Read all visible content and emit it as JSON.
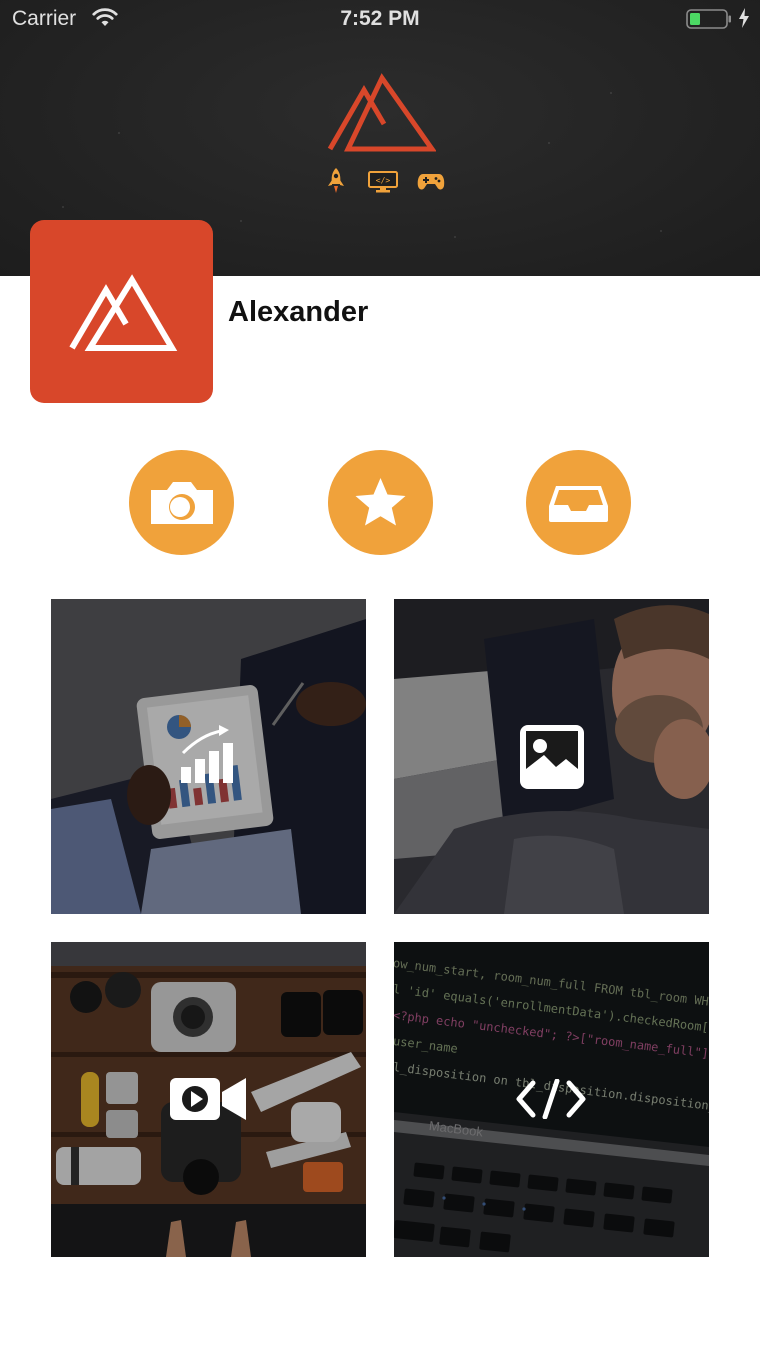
{
  "status_bar": {
    "carrier": "Carrier",
    "time": "7:52 PM"
  },
  "header": {
    "logo_icon": "mountain-logo-icon",
    "category_icons": [
      "rocket-icon",
      "code-monitor-icon",
      "gamepad-icon"
    ],
    "monitor_label": "</>"
  },
  "profile": {
    "name": "Alexander",
    "avatar_icon": "mountain-logo-icon"
  },
  "actions": [
    {
      "name": "camera-button",
      "icon": "camera-icon"
    },
    {
      "name": "favorites-button",
      "icon": "star-icon"
    },
    {
      "name": "inbox-button",
      "icon": "inbox-tray-icon"
    }
  ],
  "tiles": [
    {
      "name": "analytics-tile",
      "icon": "bar-chart-icon",
      "photo": "tablet-with-chart"
    },
    {
      "name": "photos-tile",
      "icon": "image-icon",
      "photo": "man-portrait"
    },
    {
      "name": "videos-tile",
      "icon": "video-camera-icon",
      "photo": "camera-gear-flatlay"
    },
    {
      "name": "code-tile",
      "icon": "code-icon",
      "photo": "laptop-code-screen"
    }
  ],
  "code_screen": {
    "lines": [
      "ow_num_start, room_num_full FROM tbl_room WHERE room_c",
      "l 'id' equals('enrollmentData').checkedRoom[\"room_name_full",
      "<?php echo \"unchecked\"; ?>[\"room_name_full\"];",
      "user_name",
      "l_disposition on tbl_disposition.disposition_user = u.user_ID"
    ],
    "brand": "MacBook"
  },
  "colors": {
    "accent_orange": "#f0a23b",
    "brand_red": "#d8472a",
    "header_dark": "#222222"
  }
}
